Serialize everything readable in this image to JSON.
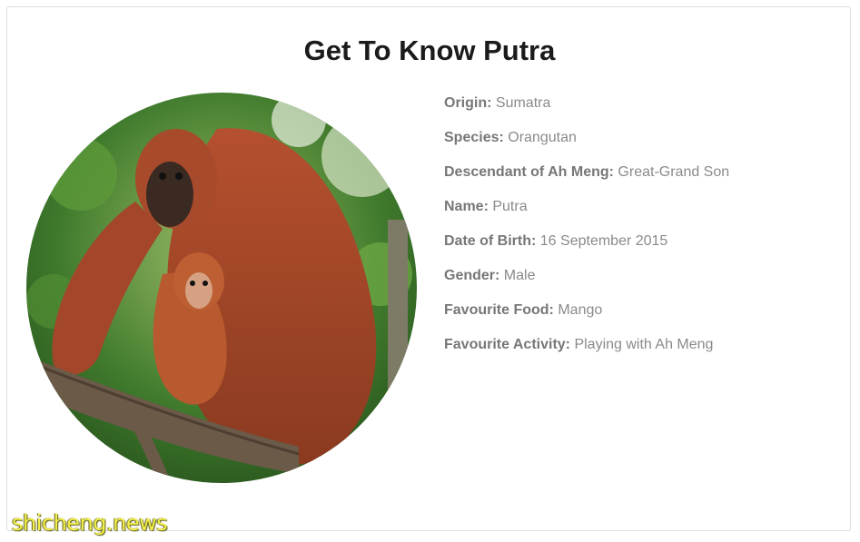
{
  "header": {
    "title": "Get To Know Putra"
  },
  "photo": {
    "subject": "orangutan mother and baby on a branch"
  },
  "facts": [
    {
      "key": "Origin:",
      "value": "Sumatra"
    },
    {
      "key": "Species:",
      "value": "Orangutan"
    },
    {
      "key": "Descendant of Ah Meng:",
      "value": "Great-Grand Son"
    },
    {
      "key": "Name:",
      "value": "Putra"
    },
    {
      "key": "Date of Birth:",
      "value": "16 September 2015"
    },
    {
      "key": "Gender:",
      "value": "Male"
    },
    {
      "key": "Favourite Food:",
      "value": "Mango"
    },
    {
      "key": "Favourite Activity:",
      "value": "Playing with Ah Meng"
    }
  ],
  "watermark": {
    "text": "shicheng.news"
  },
  "colors": {
    "title": "#1b1b1b",
    "label": "#777777",
    "value": "#8a8a8a",
    "border": "#dedede",
    "watermark": "#f3f04a"
  }
}
